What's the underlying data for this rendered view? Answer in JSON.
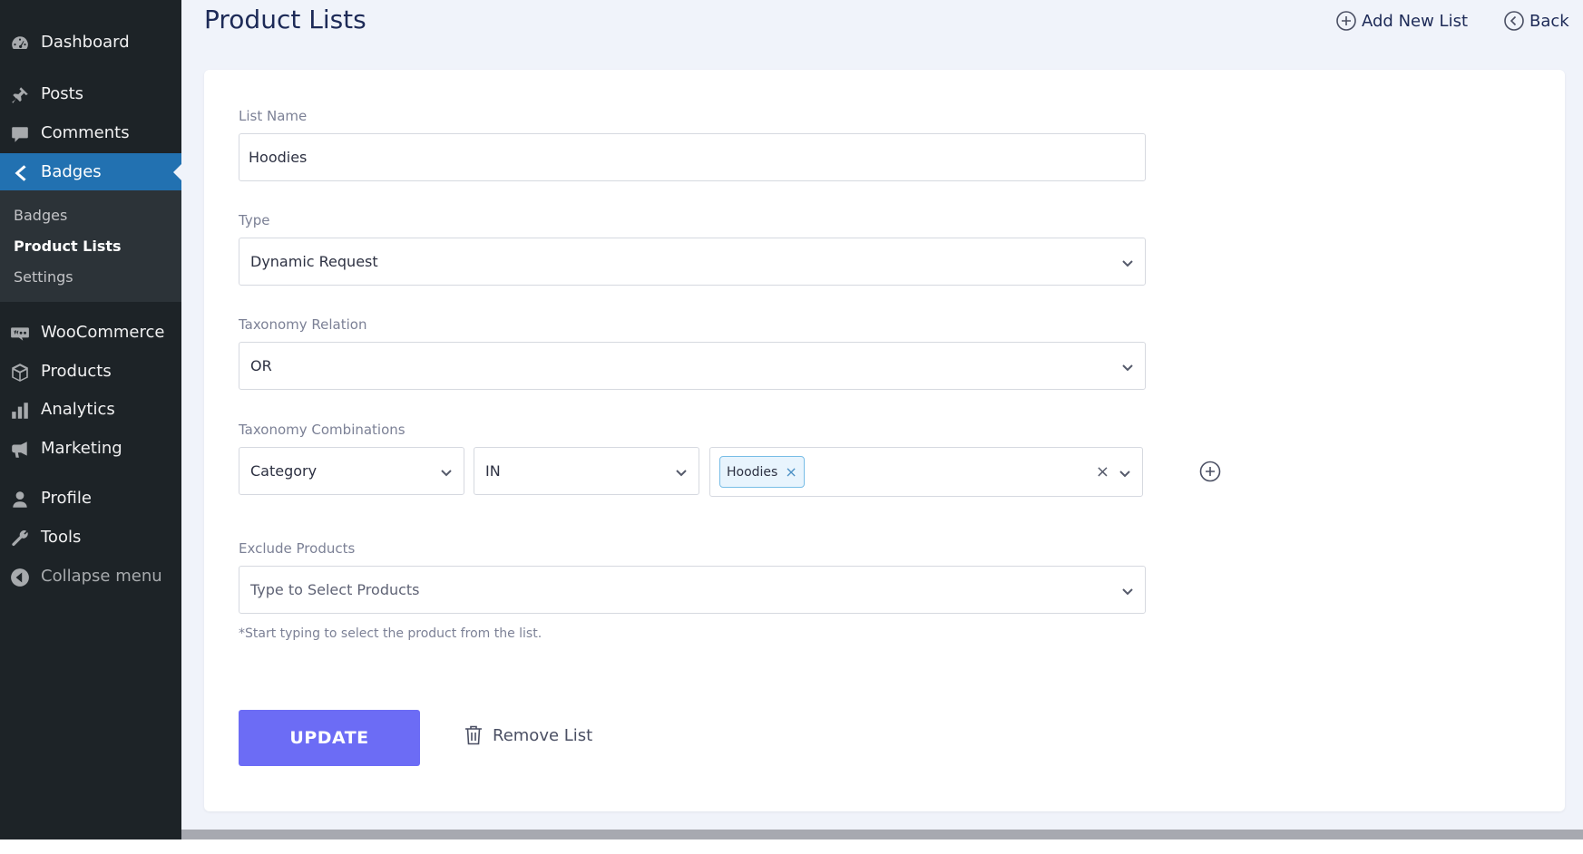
{
  "sidebar": {
    "items": [
      {
        "label": "Dashboard",
        "icon": "dashboard-icon"
      },
      {
        "label": "Posts",
        "icon": "pin-icon"
      },
      {
        "label": "Comments",
        "icon": "comment-icon"
      },
      {
        "label": "Badges",
        "icon": "chevron-left-icon",
        "active": true
      },
      {
        "label": "WooCommerce",
        "icon": "woo-icon"
      },
      {
        "label": "Products",
        "icon": "box-icon"
      },
      {
        "label": "Analytics",
        "icon": "bar-chart-icon"
      },
      {
        "label": "Marketing",
        "icon": "megaphone-icon"
      },
      {
        "label": "Profile",
        "icon": "user-icon"
      },
      {
        "label": "Tools",
        "icon": "wrench-icon"
      },
      {
        "label": "Collapse menu",
        "icon": "collapse-icon"
      }
    ],
    "submenu": [
      "Badges",
      "Product Lists",
      "Settings"
    ],
    "current_submenu": "Product Lists"
  },
  "header": {
    "title": "Product Lists",
    "add_new_label": "Add New List",
    "back_label": "Back"
  },
  "form": {
    "list_name_label": "List Name",
    "list_name_value": "Hoodies",
    "type_label": "Type",
    "type_value": "Dynamic Request",
    "relation_label": "Taxonomy Relation",
    "relation_value": "OR",
    "combinations_label": "Taxonomy Combinations",
    "combo_taxonomy": "Category",
    "combo_operator": "IN",
    "combo_terms": [
      "Hoodies"
    ],
    "exclude_label": "Exclude Products",
    "exclude_placeholder": "Type to Select Products",
    "exclude_helper": "*Start typing to select the product from the list.",
    "update_label": "UPDATE",
    "remove_label": "Remove List"
  },
  "colors": {
    "sidebar_bg": "#1d2327",
    "active_menu": "#2271b1",
    "content_bg": "#f0f3fa",
    "primary_button": "#6c6cf5",
    "title_color": "#1d2a57"
  }
}
